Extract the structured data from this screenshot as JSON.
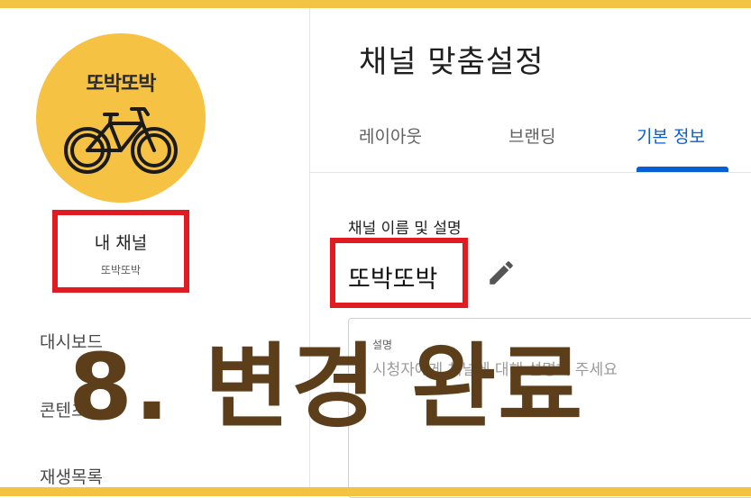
{
  "sidebar": {
    "avatar_text": "또박또박",
    "my_channel_label": "내 채널",
    "my_channel_name": "또박또박",
    "nav": {
      "dashboard": "대시보드",
      "content": "콘텐츠",
      "playlists": "재생목록"
    }
  },
  "main": {
    "title": "채널 맞춤설정",
    "tabs": [
      {
        "label": "레이아웃"
      },
      {
        "label": "브랜딩"
      },
      {
        "label": "기본 정보"
      }
    ],
    "section_label": "채널 이름 및 설명",
    "channel_name": "또박또박",
    "description": {
      "label": "설명",
      "placeholder": "시청자에게 채널에 대해 설명해 주세요"
    }
  },
  "overlay": {
    "caption": "8. 변경 완료"
  },
  "colors": {
    "frame": "#f3c343",
    "avatar_bg": "#f6c243",
    "highlight_box": "#e11b22",
    "active_tab": "#065fd4",
    "caption": "#5d3e1a"
  },
  "icons": {
    "edit": "pencil-icon"
  }
}
